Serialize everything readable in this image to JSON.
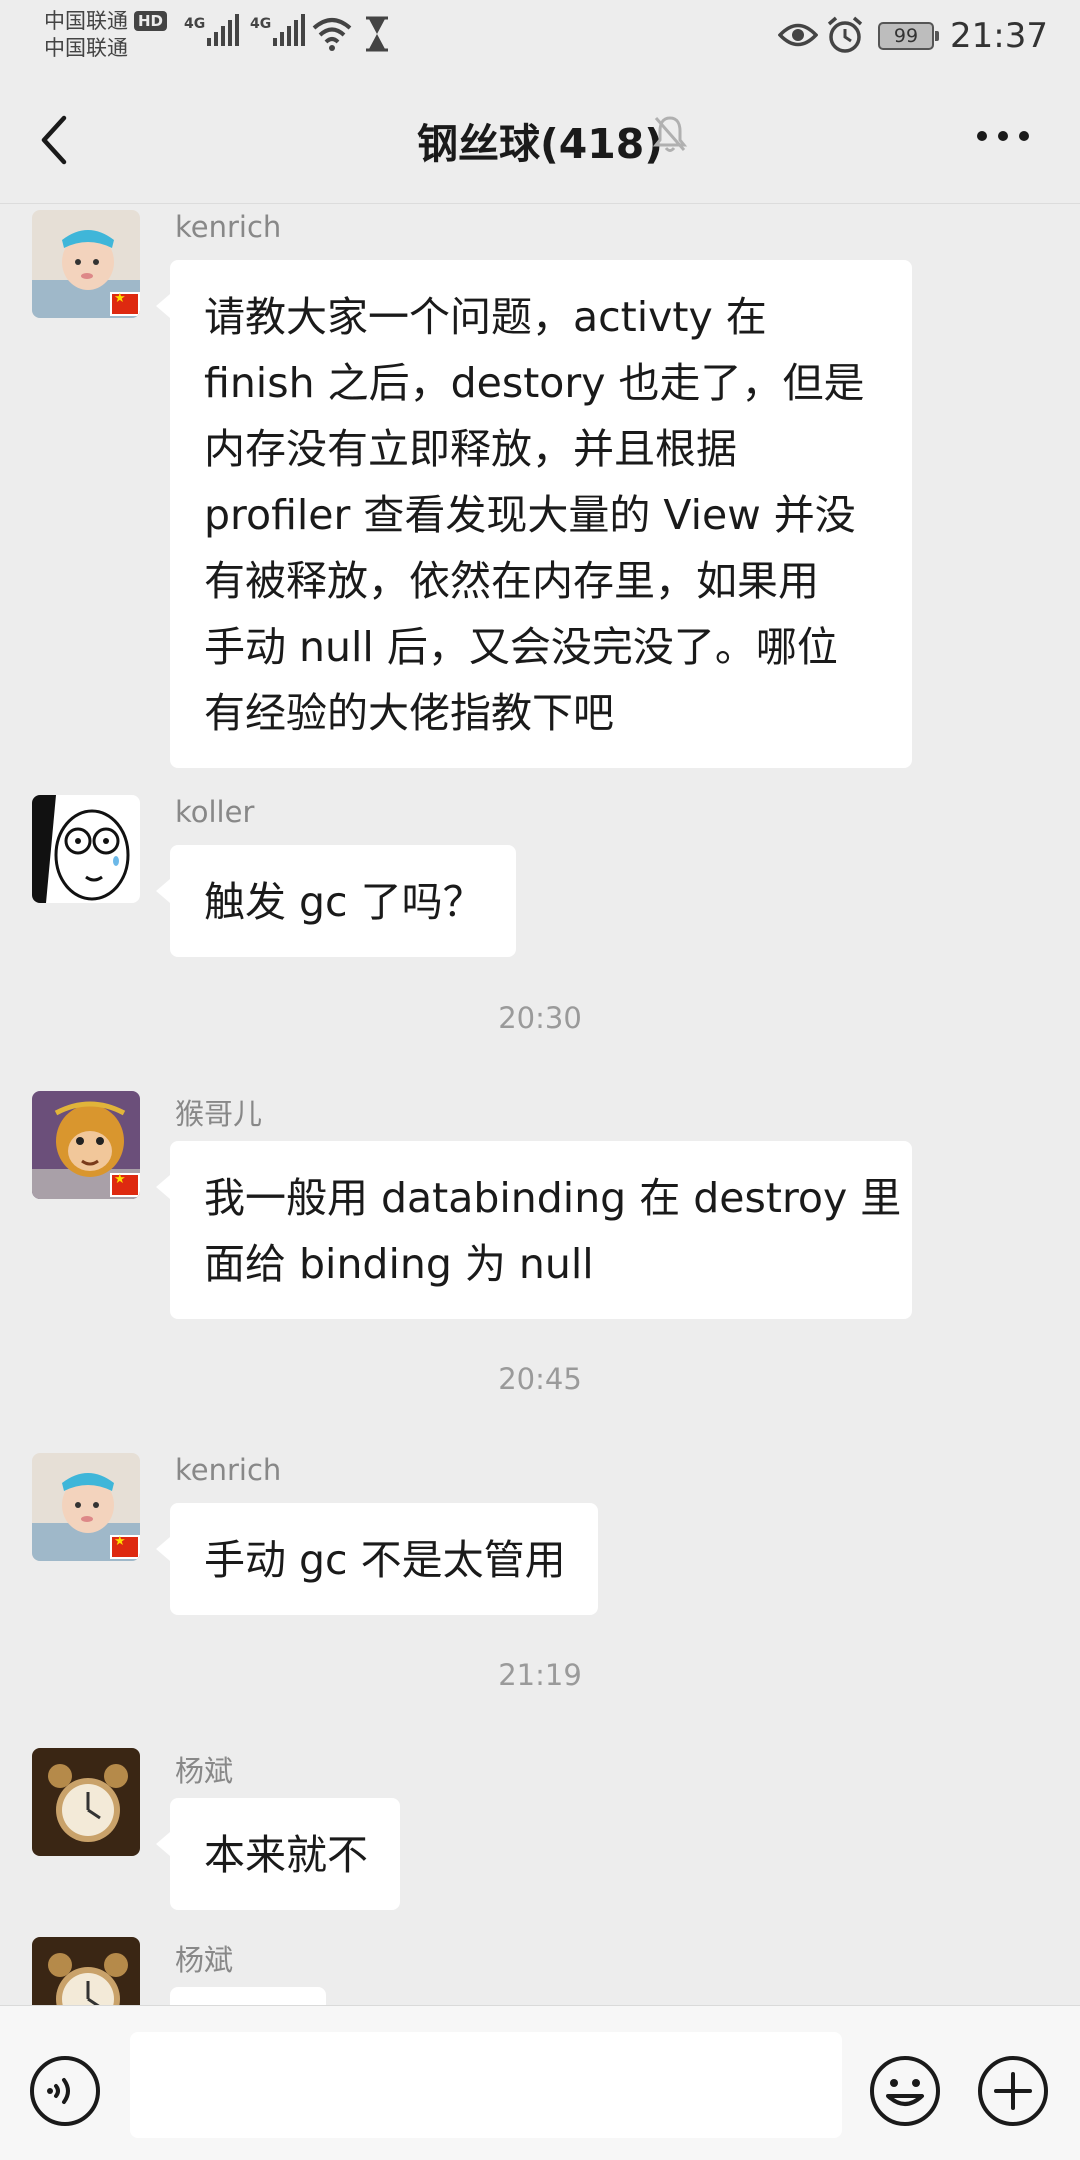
{
  "status_bar": {
    "carrier_1": "中国联通",
    "hd_badge": "HD",
    "carrier_2": "中国联通",
    "network_1": "4G",
    "network_2": "4G",
    "battery": "99",
    "time": "21:37"
  },
  "header": {
    "title": "钢丝球(418)"
  },
  "messages": [
    {
      "type": "message",
      "sender": "kenrich",
      "avatar": "baby-photo",
      "lines": [
        "请教大家一个问题，activty 在",
        "finish 之后，destory 也走了，但是",
        "内存没有立即释放，并且根据",
        "profiler 查看发现大量的 View 并没",
        "有被释放，依然在内存里，如果用",
        "手动 null 后，又会没完没了。哪位",
        "有经验的大佬指教下吧"
      ]
    },
    {
      "type": "message",
      "sender": "koller",
      "avatar": "cartoon-face",
      "lines": [
        "触发 gc 了吗？"
      ]
    },
    {
      "type": "time",
      "text": "20:30"
    },
    {
      "type": "message",
      "sender": "猴哥儿",
      "avatar": "monkey-king",
      "lines": [
        "我一般用 databinding 在 destroy 里",
        "面给 binding 为 null"
      ]
    },
    {
      "type": "time",
      "text": "20:45"
    },
    {
      "type": "message",
      "sender": "kenrich",
      "avatar": "baby-photo",
      "lines": [
        "手动 gc 不是太管用"
      ]
    },
    {
      "type": "time",
      "text": "21:19"
    },
    {
      "type": "message",
      "sender": "杨斌",
      "avatar": "alarm-clock-photo",
      "lines": [
        "本来就不"
      ]
    },
    {
      "type": "message",
      "sender": "杨斌",
      "avatar": "alarm-clock-photo",
      "lines": [
        ""
      ]
    }
  ],
  "input_bar": {
    "value": "",
    "placeholder": ""
  },
  "colors": {
    "background": "#ededed",
    "bubble": "#ffffff",
    "text": "#1a1a1a",
    "muted": "#888888"
  }
}
